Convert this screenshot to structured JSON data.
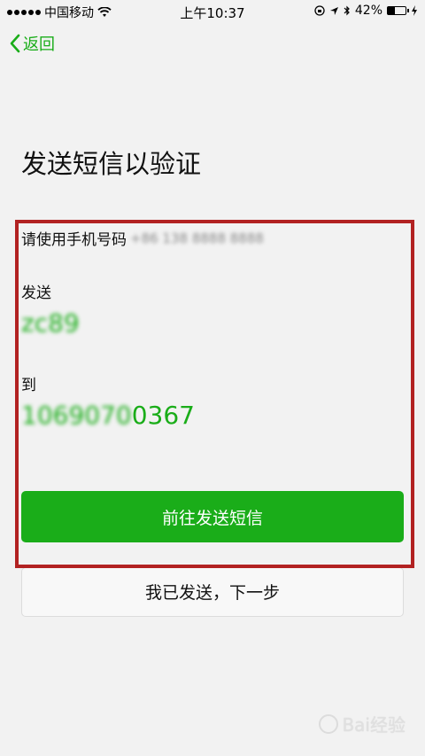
{
  "status_bar": {
    "carrier": "中国移动",
    "time": "上午10:37",
    "battery_percent": "42%",
    "battery_level": 0.42
  },
  "nav": {
    "back_label": "返回"
  },
  "page": {
    "title": "发送短信以验证"
  },
  "verification": {
    "phone_label": "请使用手机号码",
    "phone_number_masked": "+86 138 8888 8888",
    "send_label": "发送",
    "code_hidden": "zc",
    "code_visible": "89",
    "to_label": "到",
    "number_hidden": "1069070",
    "number_visible": "0367"
  },
  "buttons": {
    "send_sms": "前往发送短信",
    "already_sent": "我已发送，下一步"
  },
  "watermark": {
    "text": "Bai经验"
  },
  "colors": {
    "accent": "#1aad19",
    "background": "#f2f2f2",
    "highlight": "#b22222"
  }
}
